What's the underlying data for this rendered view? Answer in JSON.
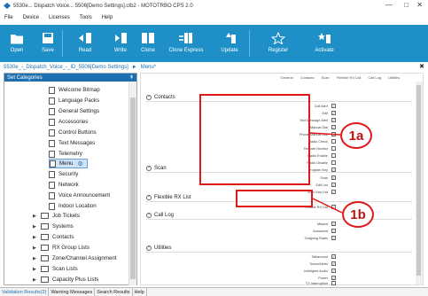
{
  "window": {
    "title": "5530e... Dispatch Voice... 5506[Demo Settings].ctb2 - MOTOTRBO CPS 2.0",
    "min": "—",
    "max": "□",
    "close": "✕"
  },
  "menu": [
    "File",
    "Device",
    "Licenses",
    "Tools",
    "Help"
  ],
  "toolbar": [
    {
      "label": "Open",
      "icon": "folder-icon"
    },
    {
      "label": "Save",
      "icon": "save-icon"
    },
    {
      "label": "Read",
      "icon": "read-icon"
    },
    {
      "label": "Write",
      "icon": "write-icon"
    },
    {
      "label": "Clone",
      "icon": "clone-icon"
    },
    {
      "label": "Clone Express",
      "icon": "clone-express-icon"
    },
    {
      "label": "Update",
      "icon": "update-icon"
    },
    {
      "label": "Register",
      "icon": "register-icon"
    },
    {
      "label": "Activate",
      "icon": "activate-icon"
    }
  ],
  "breadcrumb": {
    "path": "5530e_-_Dispatch_Voice_-_ID_5506[Demo Settings]",
    "sep": "►",
    "page": "Menu*",
    "close": "✖"
  },
  "left": {
    "header": "Set Categories",
    "pin": "⇞",
    "items": [
      {
        "label": "Welcome Bitmap",
        "type": "doc"
      },
      {
        "label": "Language Packs",
        "type": "doc"
      },
      {
        "label": "General Settings",
        "type": "doc"
      },
      {
        "label": "Accessories",
        "type": "doc"
      },
      {
        "label": "Control Buttons",
        "type": "doc"
      },
      {
        "label": "Text Messages",
        "type": "doc"
      },
      {
        "label": "Telemetry",
        "type": "doc"
      },
      {
        "label": "Menu",
        "type": "doc",
        "selected": true
      },
      {
        "label": "Security",
        "type": "doc"
      },
      {
        "label": "Network",
        "type": "doc"
      },
      {
        "label": "Voice Announcement",
        "type": "doc"
      },
      {
        "label": "Indoor Location",
        "type": "doc"
      },
      {
        "label": "Job Tickets",
        "type": "folder"
      },
      {
        "label": "Systems",
        "type": "folder"
      },
      {
        "label": "Contacts",
        "type": "folder"
      },
      {
        "label": "RX Group Lists",
        "type": "folder"
      },
      {
        "label": "Zone/Channel Assignment",
        "type": "folder"
      },
      {
        "label": "Scan Lists",
        "type": "folder"
      },
      {
        "label": "Capacity Plus Lists",
        "type": "folder"
      }
    ]
  },
  "main": {
    "tabs": [
      "General",
      "Contacts",
      "Scan",
      "Flexible RX List",
      "Call Log",
      "Utilities"
    ],
    "sections": [
      {
        "title": "Contacts",
        "fields": [
          "Call Alert",
          "Edit",
          "Text Message Alert",
          "Manual Dial",
          "Phone Manual Dial",
          "Radio Check",
          "Remote Monitor",
          "Radio Enable",
          "Radio Disable",
          "Program Key"
        ]
      },
      {
        "title": "Scan",
        "fields": [
          "Scan",
          "Edit List",
          "Scan Key List"
        ]
      },
      {
        "title": "Flexible RX List",
        "fields": [
          "Flexible RX List"
        ]
      },
      {
        "title": "Call Log",
        "fields": [
          "Missed",
          "Answered",
          "Outgoing Radio"
        ]
      },
      {
        "title": "Utilities",
        "fields": [
          "Talkaround",
          "Tones/Alerts",
          "Intelligent Audio",
          "Power",
          "TX Interruption"
        ]
      }
    ]
  },
  "callouts": [
    "1a",
    "1b"
  ],
  "bottom_tabs": [
    "Validation Results(2)",
    "Warning Messages",
    "Search Results",
    "Help"
  ],
  "colors": {
    "toolbar": "#1e90c7",
    "accent": "#1e6fb0",
    "callout": "#e01818"
  }
}
